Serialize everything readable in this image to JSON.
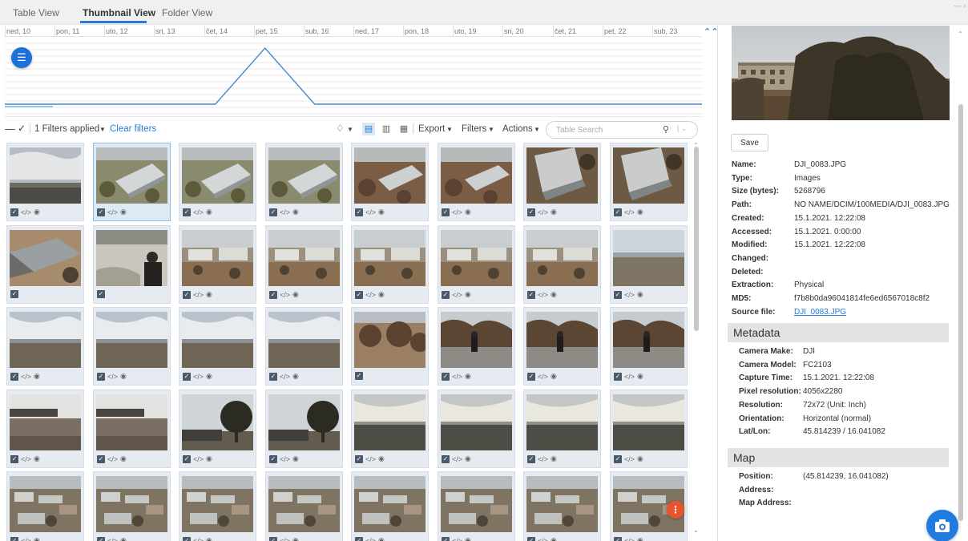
{
  "tabs": [
    {
      "label": "Table View",
      "active": false
    },
    {
      "label": "Thumbnail View",
      "active": true
    },
    {
      "label": "Folder View",
      "active": false
    }
  ],
  "timeline": {
    "days": [
      "ned, 10",
      "pon, 11",
      "uto, 12",
      "sri, 13",
      "čet, 14",
      "pet, 15",
      "sub, 16",
      "ned, 17",
      "pon, 18",
      "uto, 19",
      "sri, 20",
      "čet, 21",
      "pet, 22",
      "sub, 23"
    ],
    "peak_day": "pet, 15",
    "line_color": "#4a86c8"
  },
  "toolbar": {
    "filters_applied": "1 Filters applied",
    "clear_filters": "Clear filters",
    "export": "Export",
    "filters": "Filters",
    "actions": "Actions",
    "search_placeholder": "Table Search"
  },
  "grid": {
    "selected_index": 1,
    "thumbnails": [
      {
        "scene": "sky"
      },
      {
        "scene": "aerial"
      },
      {
        "scene": "aerial"
      },
      {
        "scene": "aerial"
      },
      {
        "scene": "aerial-brown"
      },
      {
        "scene": "aerial-brown"
      },
      {
        "scene": "aerial-steep"
      },
      {
        "scene": "aerial-steep"
      },
      {
        "scene": "roof",
        "icons": "check"
      },
      {
        "scene": "snow-person",
        "icons": "check"
      },
      {
        "scene": "buildings"
      },
      {
        "scene": "buildings"
      },
      {
        "scene": "buildings"
      },
      {
        "scene": "buildings"
      },
      {
        "scene": "buildings"
      },
      {
        "scene": "horizon"
      },
      {
        "scene": "horizon-cloud"
      },
      {
        "scene": "horizon-cloud"
      },
      {
        "scene": "horizon-cloud"
      },
      {
        "scene": "horizon-cloud"
      },
      {
        "scene": "trees-brown",
        "icons": "check"
      },
      {
        "scene": "road-person"
      },
      {
        "scene": "road-person"
      },
      {
        "scene": "road-person"
      },
      {
        "scene": "gravel"
      },
      {
        "scene": "gravel"
      },
      {
        "scene": "tree-building"
      },
      {
        "scene": "tree-building"
      },
      {
        "scene": "sunset"
      },
      {
        "scene": "sunset"
      },
      {
        "scene": "sunset"
      },
      {
        "scene": "sunset"
      },
      {
        "scene": "aerial-city"
      },
      {
        "scene": "aerial-city"
      },
      {
        "scene": "aerial-city"
      },
      {
        "scene": "aerial-city"
      },
      {
        "scene": "aerial-city"
      },
      {
        "scene": "aerial-city"
      },
      {
        "scene": "aerial-city"
      },
      {
        "scene": "aerial-city"
      }
    ]
  },
  "details": {
    "save_label": "Save",
    "properties": [
      {
        "key": "Name:",
        "value": "DJI_0083.JPG"
      },
      {
        "key": "Type:",
        "value": "Images"
      },
      {
        "key": "Size (bytes):",
        "value": "5268796"
      },
      {
        "key": "Path:",
        "value": "NO NAME/DCIM/100MEDIA/DJI_0083.JPG"
      },
      {
        "key": "Created:",
        "value": "15.1.2021. 12:22:08"
      },
      {
        "key": "Accessed:",
        "value": "15.1.2021. 0:00:00"
      },
      {
        "key": "Modified:",
        "value": "15.1.2021. 12:22:08"
      },
      {
        "key": "Changed:",
        "value": ""
      },
      {
        "key": "Deleted:",
        "value": ""
      },
      {
        "key": "Extraction:",
        "value": "Physical"
      },
      {
        "key": "MD5:",
        "value": "f7b8b0da96041814fe6ed6567018c8f2"
      },
      {
        "key": "Source file:",
        "value": "DJI_0083.JPG",
        "link": true
      }
    ],
    "metadata_title": "Metadata",
    "metadata": [
      {
        "key": "Camera Make:",
        "value": "DJI"
      },
      {
        "key": "Camera Model:",
        "value": "FC2103"
      },
      {
        "key": "Capture Time:",
        "value": "15.1.2021. 12:22:08"
      },
      {
        "key": "Pixel resolution:",
        "value": "4056x2280"
      },
      {
        "key": "Resolution:",
        "value": "72x72 (Unit: Inch)"
      },
      {
        "key": "Orientation:",
        "value": "Horizontal (normal)"
      },
      {
        "key": "Lat/Lon:",
        "value": "45.814239 / 16.041082"
      }
    ],
    "map_title": "Map",
    "map": [
      {
        "key": "Position:",
        "value": "(45.814239, 16.041082)"
      },
      {
        "key": "Address:",
        "value": ""
      },
      {
        "key": "Map Address:",
        "value": ""
      }
    ]
  },
  "colors": {
    "accent": "#2a7bd3",
    "fab_blue": "#1f6fd8",
    "fab_orange": "#e8542b"
  }
}
